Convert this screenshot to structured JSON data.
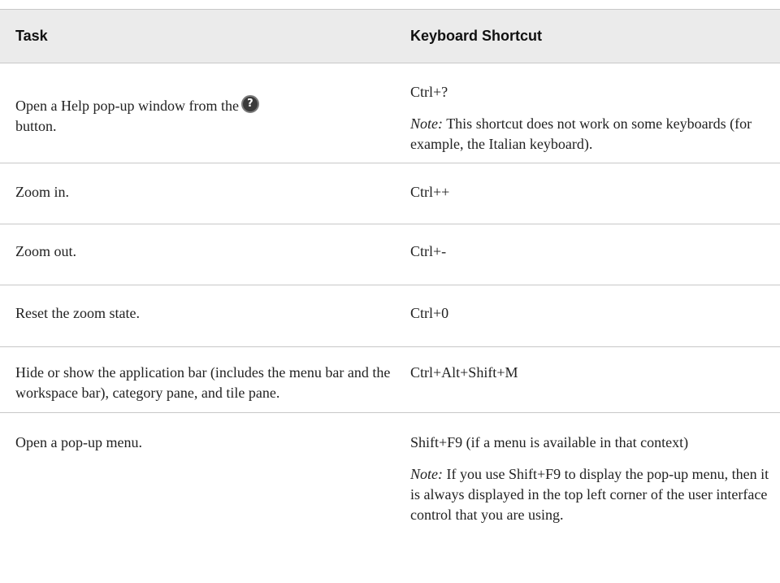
{
  "table": {
    "headers": {
      "task": "Task",
      "shortcut": "Keyboard Shortcut"
    },
    "rows": [
      {
        "task_before_icon": "Open a Help pop-up window from the",
        "task_after_icon": "button.",
        "icon": "help-question-icon",
        "shortcut": "Ctrl+?",
        "note_label": "Note:",
        "note": "This shortcut does not work on some keyboards (for example, the Italian keyboard)."
      },
      {
        "task": "Zoom in.",
        "shortcut": "Ctrl++"
      },
      {
        "task": "Zoom out.",
        "shortcut": "Ctrl+-"
      },
      {
        "task": "Reset the zoom state.",
        "shortcut": "Ctrl+0"
      },
      {
        "task": "Hide or show the application bar (includes the menu bar and the workspace bar), category pane, and tile pane.",
        "shortcut": "Ctrl+Alt+Shift+M"
      },
      {
        "task": "Open a pop-up menu.",
        "shortcut": "Shift+F9 (if a menu is available in that context)",
        "note_label": "Note:",
        "note": "If you use Shift+F9 to display the pop-up menu, then it is always displayed in the top left corner of the user interface control that you are using."
      }
    ]
  }
}
